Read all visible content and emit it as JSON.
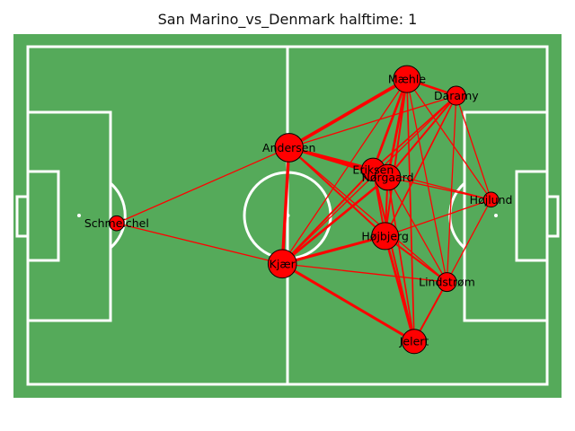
{
  "title": "San Marino_vs_Denmark halftime: 1",
  "colors": {
    "pitch": "#55aa5a",
    "lines": "#ffffff",
    "node_fill": "#ff0000",
    "node_stroke": "#000000",
    "edge": "#ff0000"
  },
  "chart_data": {
    "type": "network",
    "players": [
      {
        "name": "Mæhle",
        "x": 73.0,
        "y": 9.6,
        "size": 1.0
      },
      {
        "name": "Daramy",
        "x": 82.5,
        "y": 14.5,
        "size": 0.7
      },
      {
        "name": "Andersen",
        "x": 50.3,
        "y": 29.9,
        "size": 1.05
      },
      {
        "name": "Eriksen",
        "x": 66.5,
        "y": 36.4,
        "size": 0.85
      },
      {
        "name": "Nørgaard",
        "x": 69.3,
        "y": 38.7,
        "size": 0.95
      },
      {
        "name": "Højlund",
        "x": 89.2,
        "y": 45.3,
        "size": 0.55
      },
      {
        "name": "Schmeichel",
        "x": 17.1,
        "y": 52.3,
        "size": 0.55
      },
      {
        "name": "Højbjerg",
        "x": 68.8,
        "y": 56.1,
        "size": 1.0
      },
      {
        "name": "Kjær",
        "x": 49.0,
        "y": 64.3,
        "size": 1.05
      },
      {
        "name": "Lindstrøm",
        "x": 80.7,
        "y": 69.7,
        "size": 0.7
      },
      {
        "name": "Jelert",
        "x": 74.4,
        "y": 87.3,
        "size": 0.9
      }
    ],
    "edges": [
      [
        "Mæhle",
        "Andersen",
        4.5
      ],
      [
        "Mæhle",
        "Daramy",
        3
      ],
      [
        "Mæhle",
        "Eriksen",
        3
      ],
      [
        "Mæhle",
        "Nørgaard",
        3
      ],
      [
        "Mæhle",
        "Højbjerg",
        2
      ],
      [
        "Mæhle",
        "Jelert",
        1.5
      ],
      [
        "Mæhle",
        "Kjær",
        1
      ],
      [
        "Mæhle",
        "Lindstrøm",
        1
      ],
      [
        "Mæhle",
        "Højlund",
        1
      ],
      [
        "Daramy",
        "Andersen",
        1
      ],
      [
        "Daramy",
        "Eriksen",
        1.5
      ],
      [
        "Daramy",
        "Nørgaard",
        2
      ],
      [
        "Daramy",
        "Højbjerg",
        1.5
      ],
      [
        "Daramy",
        "Kjær",
        1
      ],
      [
        "Daramy",
        "Højlund",
        1
      ],
      [
        "Daramy",
        "Lindstrøm",
        1
      ],
      [
        "Andersen",
        "Eriksen",
        4
      ],
      [
        "Andersen",
        "Nørgaard",
        3
      ],
      [
        "Andersen",
        "Kjær",
        4
      ],
      [
        "Andersen",
        "Højbjerg",
        2
      ],
      [
        "Andersen",
        "Schmeichel",
        1
      ],
      [
        "Andersen",
        "Lindstrøm",
        1
      ],
      [
        "Eriksen",
        "Nørgaard",
        4
      ],
      [
        "Eriksen",
        "Højbjerg",
        2
      ],
      [
        "Eriksen",
        "Kjær",
        2
      ],
      [
        "Eriksen",
        "Jelert",
        2
      ],
      [
        "Eriksen",
        "Højlund",
        1
      ],
      [
        "Nørgaard",
        "Højbjerg",
        2
      ],
      [
        "Nørgaard",
        "Kjær",
        3
      ],
      [
        "Nørgaard",
        "Højlund",
        1
      ],
      [
        "Nørgaard",
        "Jelert",
        1.5
      ],
      [
        "Nørgaard",
        "Lindstrøm",
        1
      ],
      [
        "Højbjerg",
        "Kjær",
        3.5
      ],
      [
        "Højbjerg",
        "Jelert",
        3
      ],
      [
        "Højbjerg",
        "Lindstrøm",
        2
      ],
      [
        "Højbjerg",
        "Højlund",
        1
      ],
      [
        "Kjær",
        "Jelert",
        3.5
      ],
      [
        "Kjær",
        "Lindstrøm",
        1
      ],
      [
        "Kjær",
        "Schmeichel",
        1
      ],
      [
        "Lindstrøm",
        "Jelert",
        2
      ],
      [
        "Lindstrøm",
        "Højlund",
        1
      ]
    ]
  }
}
